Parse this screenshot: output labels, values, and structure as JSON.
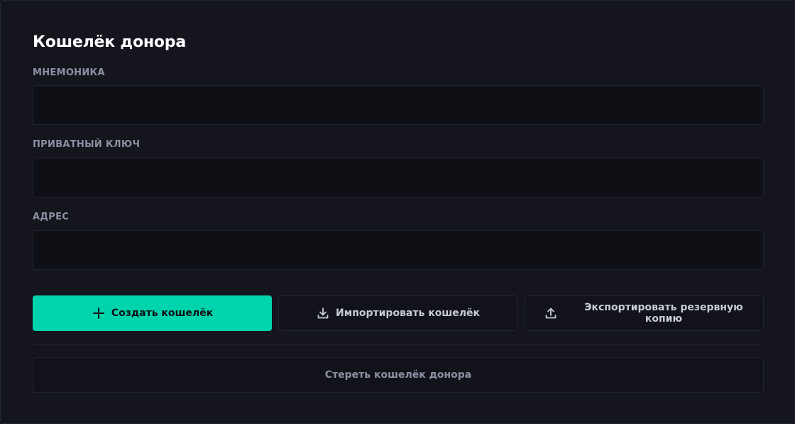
{
  "panel": {
    "title": "Кошелёк донора"
  },
  "fields": {
    "mnemonic": {
      "label": "МНЕМОНИКА",
      "value": "",
      "placeholder": ""
    },
    "private_key": {
      "label": "ПРИВАТНЫЙ КЛЮЧ",
      "value": "",
      "placeholder": ""
    },
    "address": {
      "label": "АДРЕС",
      "value": "",
      "placeholder": ""
    }
  },
  "actions": {
    "create_label": "Создать кошелёк",
    "create_icon": "plus-icon",
    "import_label": "Импортировать кошелёк",
    "import_icon": "download-icon",
    "export_label": "Экспортировать резервную копию",
    "export_icon": "upload-icon",
    "erase_label": "Стереть кошелёк донора"
  },
  "colors": {
    "accent": "#00d4ad",
    "background": "#14151d",
    "field_background": "#0f1016",
    "label": "#8e90a3"
  }
}
